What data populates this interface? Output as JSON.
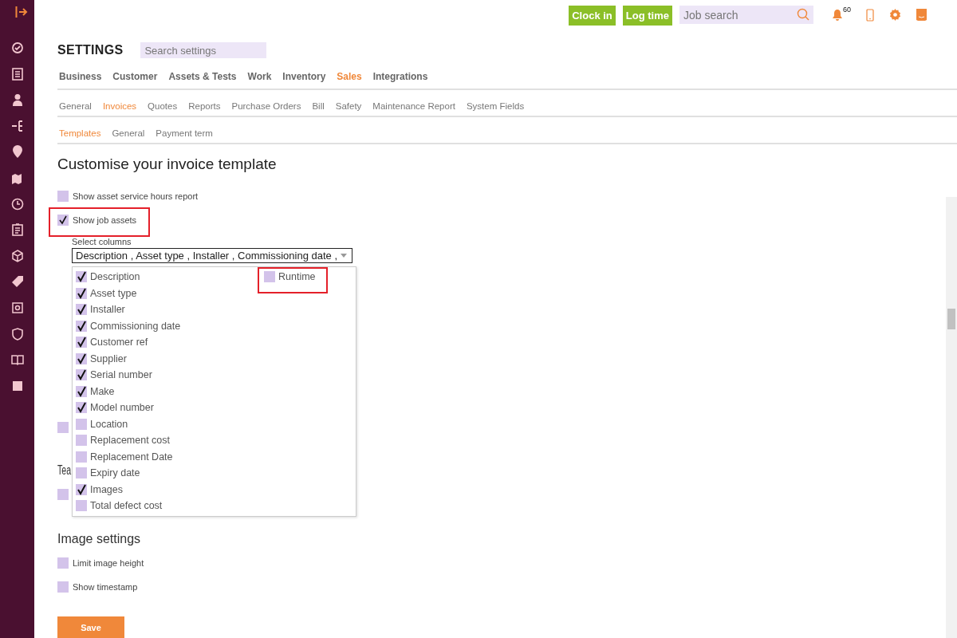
{
  "topbar": {
    "clock_in": "Clock in",
    "log_time": "Log time",
    "job_search": {
      "placeholder": "Job search"
    },
    "notification_count": "60"
  },
  "settings": {
    "title": "SETTINGS",
    "search": {
      "placeholder": "Search settings"
    }
  },
  "tabs": [
    {
      "label": "Business",
      "selected": false
    },
    {
      "label": "Customer",
      "selected": false
    },
    {
      "label": "Assets & Tests",
      "selected": false
    },
    {
      "label": "Work",
      "selected": false
    },
    {
      "label": "Inventory",
      "selected": false
    },
    {
      "label": "Sales",
      "selected": true
    },
    {
      "label": "Integrations",
      "selected": false
    }
  ],
  "subtabs": [
    {
      "label": "General",
      "selected": false
    },
    {
      "label": "Invoices",
      "selected": true
    },
    {
      "label": "Quotes",
      "selected": false
    },
    {
      "label": "Reports",
      "selected": false
    },
    {
      "label": "Purchase Orders",
      "selected": false
    },
    {
      "label": "Bill",
      "selected": false
    },
    {
      "label": "Safety",
      "selected": false
    },
    {
      "label": "Maintenance Report",
      "selected": false
    },
    {
      "label": "System Fields",
      "selected": false
    }
  ],
  "subsubtabs": [
    {
      "label": "Templates",
      "selected": true
    },
    {
      "label": "General",
      "selected": false
    },
    {
      "label": "Payment term",
      "selected": false
    }
  ],
  "heading": "Customise your invoice template",
  "options": [
    {
      "label": "Show asset service hours report",
      "checked": false
    },
    {
      "label": "Show job assets",
      "checked": true
    }
  ],
  "column_select": {
    "label": "Select columns",
    "value": "Description , Asset type , Installer , Commissioning date ,",
    "options": [
      {
        "label": "Description",
        "checked": true
      },
      {
        "label": "Asset type",
        "checked": true
      },
      {
        "label": "Installer",
        "checked": true
      },
      {
        "label": "Commissioning date",
        "checked": true
      },
      {
        "label": "Customer ref",
        "checked": true
      },
      {
        "label": "Supplier",
        "checked": true
      },
      {
        "label": "Serial number",
        "checked": true
      },
      {
        "label": "Make",
        "checked": true
      },
      {
        "label": "Model number",
        "checked": true
      },
      {
        "label": "Location",
        "checked": false
      },
      {
        "label": "Replacement cost",
        "checked": false
      },
      {
        "label": "Replacement Date",
        "checked": false
      },
      {
        "label": "Expiry date",
        "checked": false
      },
      {
        "label": "Images",
        "checked": true
      },
      {
        "label": "Total defect cost",
        "checked": false
      }
    ],
    "extra_options": [
      {
        "label": "Runtime",
        "checked": false
      }
    ]
  },
  "covered_checkbox": {
    "checked": false
  },
  "covered_heading": "Tea",
  "covered_checkbox_2": {
    "checked": false
  },
  "image_settings": {
    "heading": "Image settings",
    "options": [
      {
        "label": "Limit image height",
        "checked": false
      },
      {
        "label": "Show timestamp",
        "checked": false
      }
    ]
  },
  "save": "Save"
}
